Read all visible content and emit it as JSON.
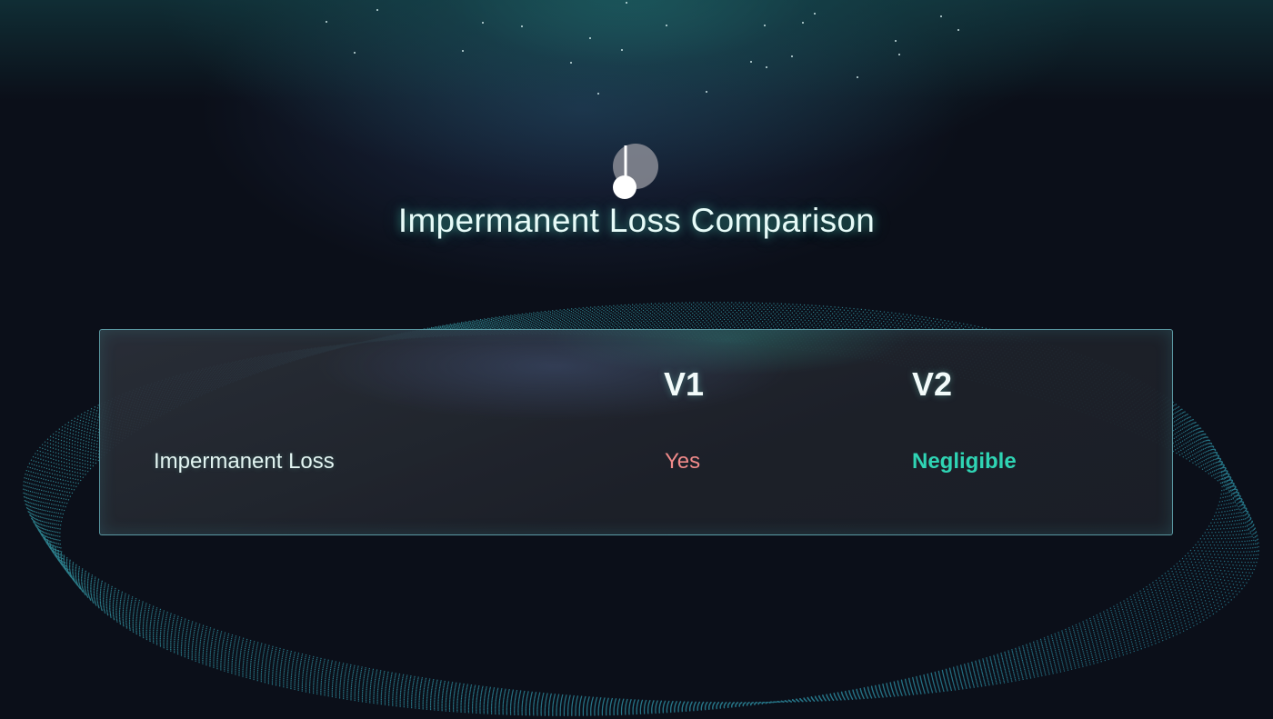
{
  "slide": {
    "title": "Impermanent Loss Comparison"
  },
  "table": {
    "columns": [
      "V1",
      "V2"
    ],
    "rows": [
      {
        "label": "Impermanent Loss",
        "v1": "Yes",
        "v2": "Negligible"
      }
    ]
  },
  "colors": {
    "background": "#0b0f19",
    "accent_teal": "#2fd4b4",
    "negative_red": "#f08a8a",
    "border": "#6ebec8"
  },
  "icons": {
    "logo": "pendulum-logo-icon"
  }
}
